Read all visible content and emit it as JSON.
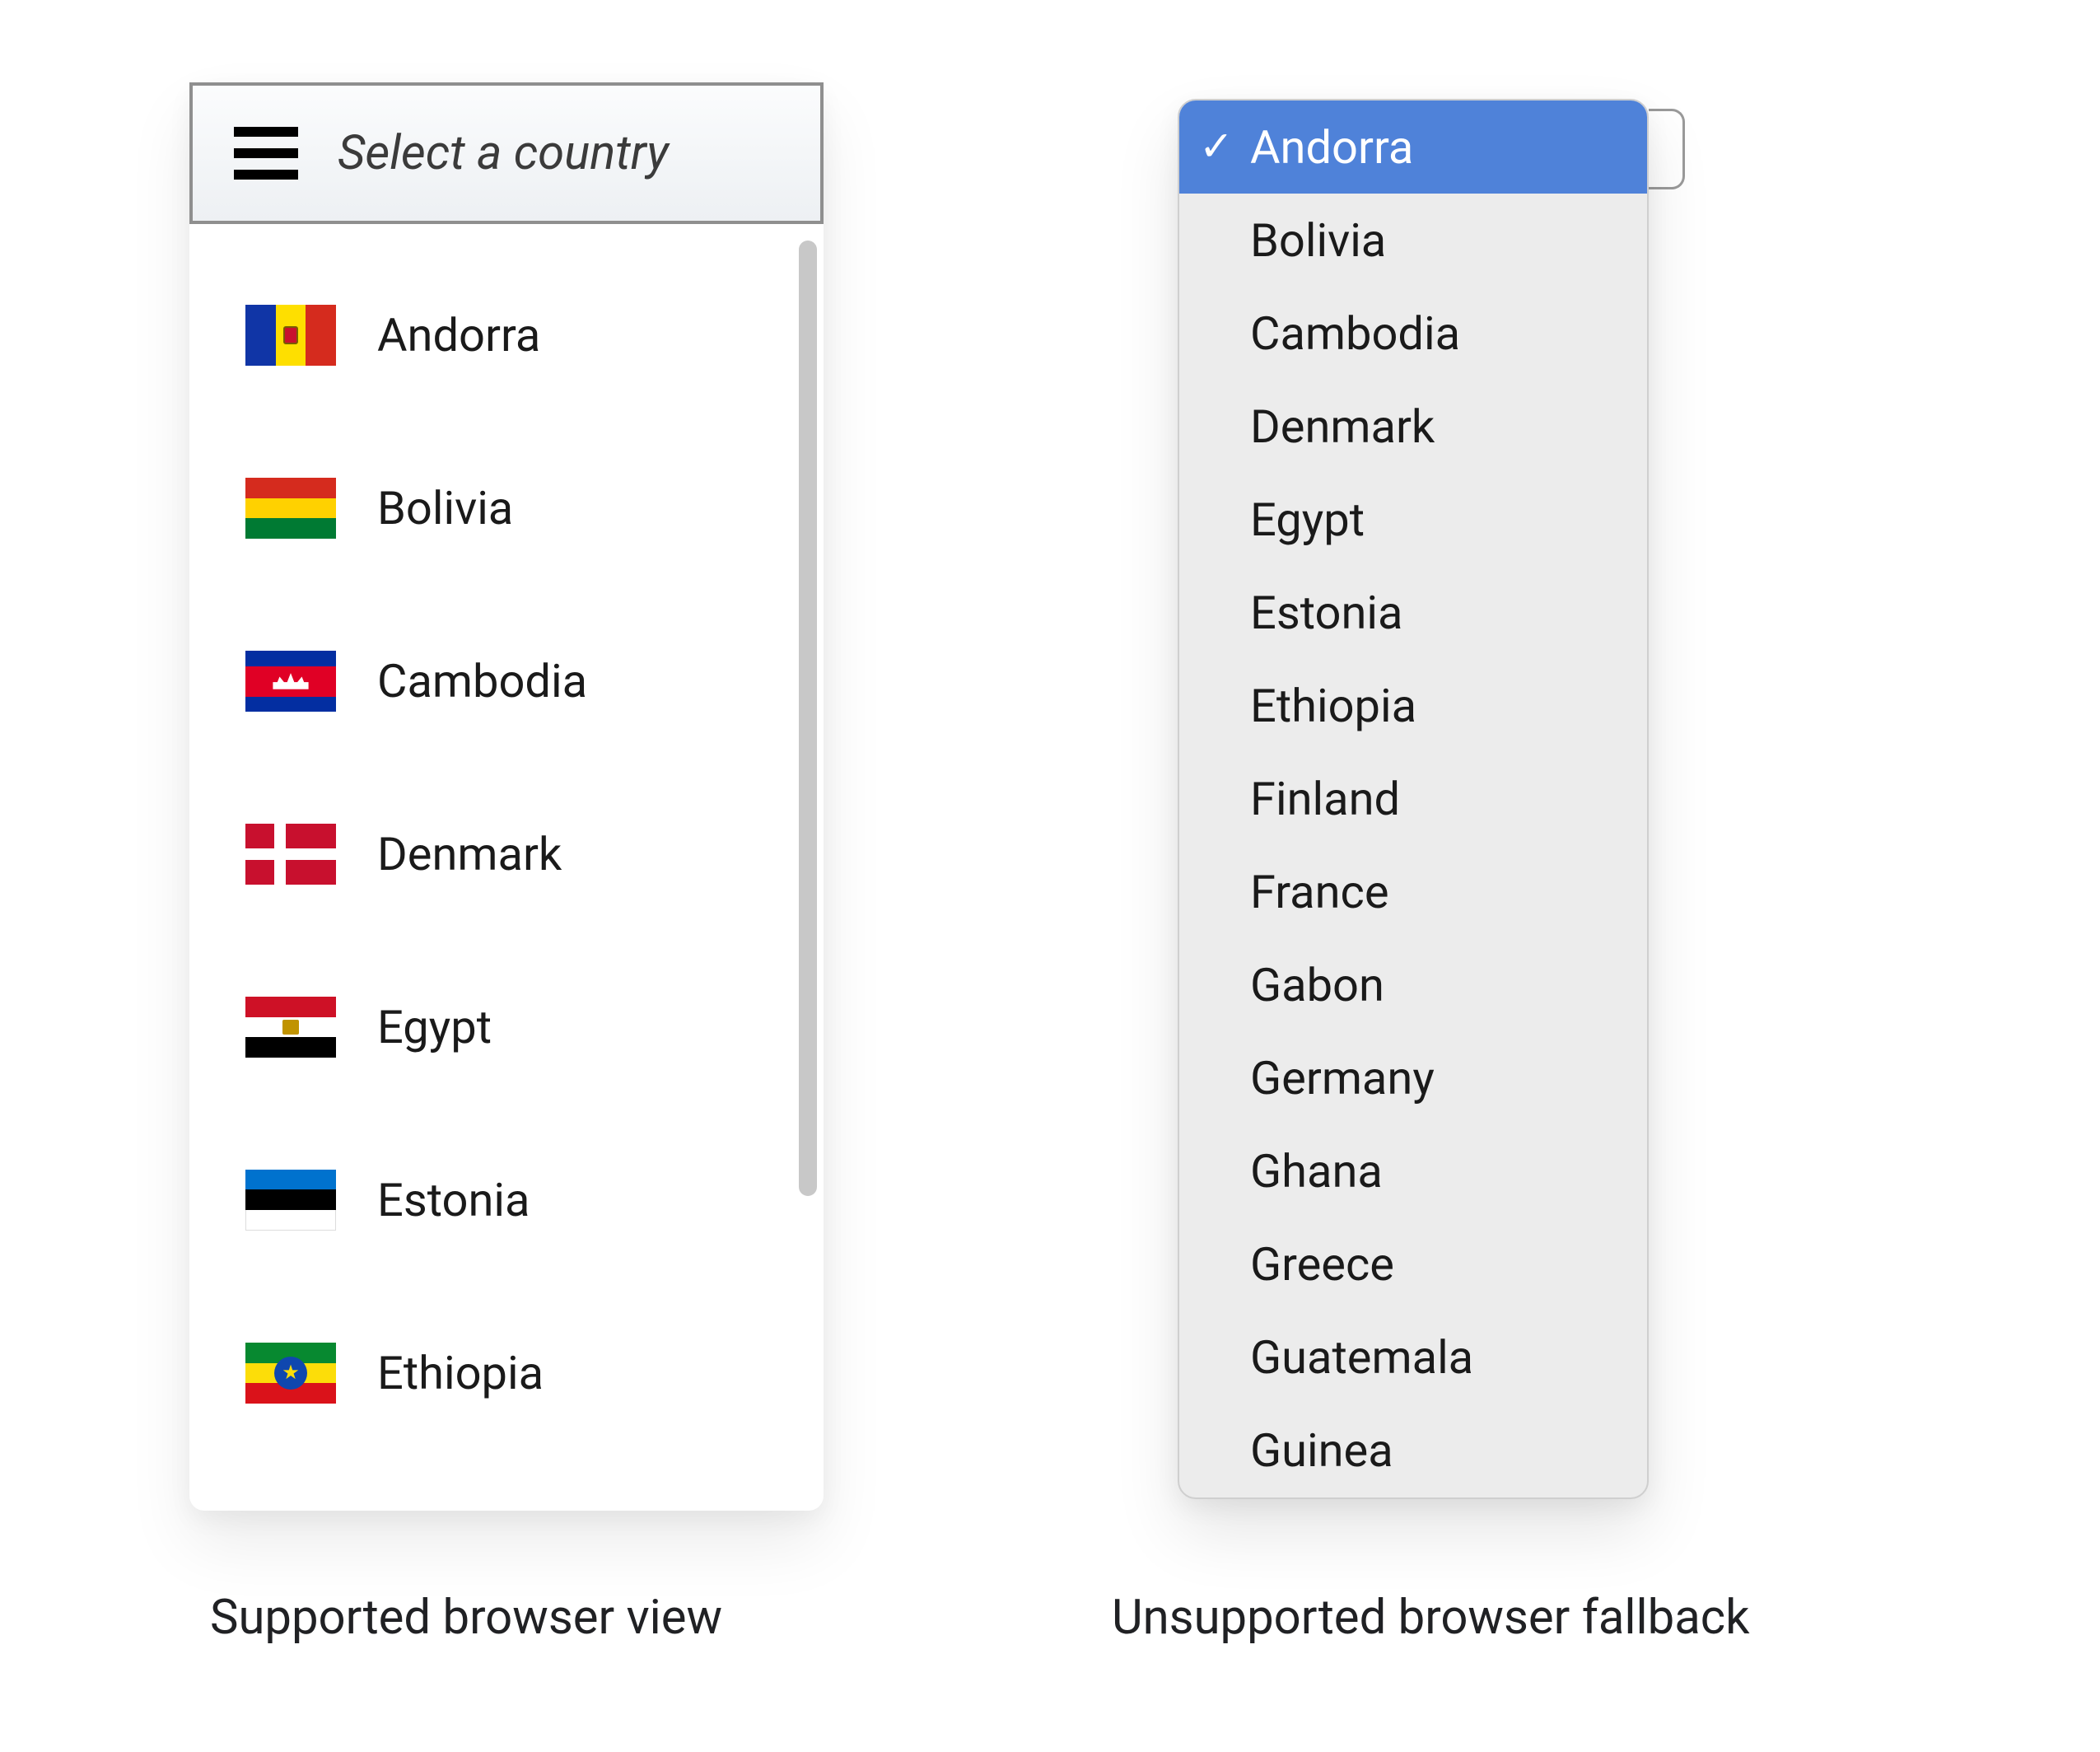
{
  "custom_select": {
    "placeholder": "Select a country",
    "options": [
      {
        "label": "Andorra",
        "flag": "andorra"
      },
      {
        "label": "Bolivia",
        "flag": "bolivia"
      },
      {
        "label": "Cambodia",
        "flag": "cambodia"
      },
      {
        "label": "Denmark",
        "flag": "denmark"
      },
      {
        "label": "Egypt",
        "flag": "egypt"
      },
      {
        "label": "Estonia",
        "flag": "estonia"
      },
      {
        "label": "Ethiopia",
        "flag": "ethiopia"
      }
    ]
  },
  "native_select": {
    "selected_index": 0,
    "options": [
      "Andorra",
      "Bolivia",
      "Cambodia",
      "Denmark",
      "Egypt",
      "Estonia",
      "Ethiopia",
      "Finland",
      "France",
      "Gabon",
      "Germany",
      "Ghana",
      "Greece",
      "Guatemala",
      "Guinea"
    ]
  },
  "captions": {
    "left": "Supported browser view",
    "right": "Unsupported browser fallback"
  }
}
